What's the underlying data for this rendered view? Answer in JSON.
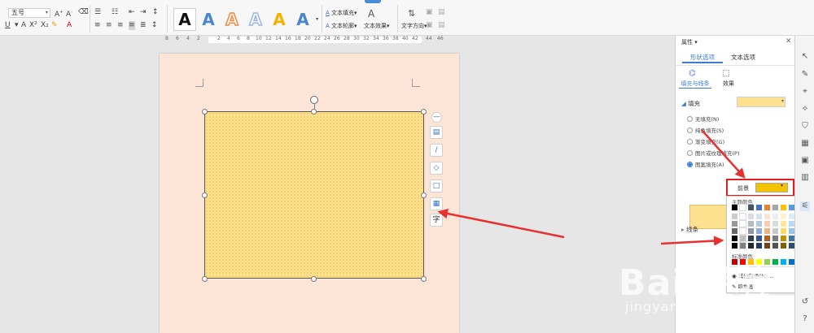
{
  "ribbon": {
    "font_size": "五号",
    "font_size_arrow": "▾",
    "wordart_letter": "A",
    "text_fill": "文本填充",
    "text_outline": "文本轮廓",
    "text_effect": "文本效果",
    "text_direction": "文字方向",
    "dropdown_arrow": "▾",
    "wordart_colors": [
      "#111111",
      "#4a86d0",
      "#f08a3a",
      "#9cb6e0",
      "#f2b400",
      "#4a86d0"
    ]
  },
  "ruler": {
    "labels": [
      "8",
      "6",
      "4",
      "2",
      "2",
      "4",
      "6",
      "8",
      "10",
      "12",
      "14",
      "16",
      "18",
      "20",
      "22",
      "24",
      "26",
      "28",
      "30",
      "32",
      "34",
      "36",
      "38",
      "40",
      "42",
      "44",
      "46"
    ]
  },
  "float_tools": {
    "labels": [
      "—",
      "▤",
      "/",
      "◇",
      "□",
      "▦",
      "字"
    ]
  },
  "panel": {
    "title": "属性",
    "close": "✕",
    "tab_shape": "形状选项",
    "tab_text": "文本选项",
    "sub_fill_line": "填充与线条",
    "sub_effect": "效果",
    "section_fill": "填充",
    "section_line": "线条",
    "fill_options": [
      {
        "label": "无填充(N)"
      },
      {
        "label": "纯色填充(S)"
      },
      {
        "label": "渐变填充(G)"
      },
      {
        "label": "图片或纹理填充(P)"
      },
      {
        "label": "图案填充(A)"
      }
    ]
  },
  "color_picker": {
    "foreground_label": "前景",
    "foreground_color": "#f5c200",
    "theme_header": "主题颜色",
    "standard_header": "标准颜色",
    "more_colors": "其他颜色(M)...",
    "eyedropper": "取色器",
    "theme_columns": [
      "#000000",
      "#ffffff",
      "#44546a",
      "#4472c4",
      "#ed7d31",
      "#a5a5a5",
      "#ffc000",
      "#5b9bd5",
      "#70ad47",
      "#264478"
    ],
    "standard_colors": [
      "#c00000",
      "#ff0000",
      "#ffc000",
      "#ffff00",
      "#92d050",
      "#00b050",
      "#00b0f0",
      "#0070c0",
      "#002060",
      "#7030a0"
    ]
  },
  "watermark": {
    "text": "Bai 经验",
    "url": "jingyan.baidu.com"
  }
}
